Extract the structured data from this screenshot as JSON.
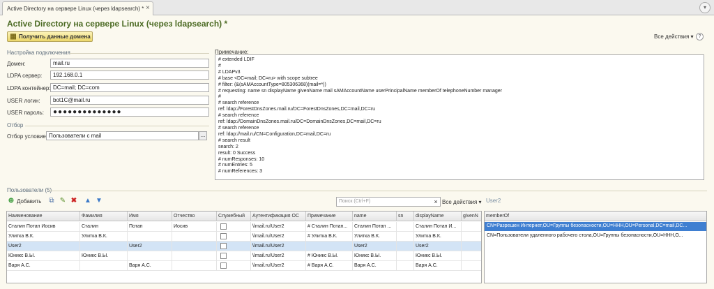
{
  "tab": {
    "title": "Active Directory на сервере Linux (через ldapsearch) *",
    "close": "×",
    "menu": "▾"
  },
  "page": {
    "title": "Active Directory на сервере Linux (через ldapsearch) *",
    "get_domain_button": "Получить данные домена",
    "all_actions": "Все действия ▾",
    "help": "?"
  },
  "connection": {
    "section": "Настройка подключения",
    "domain_label": "Домен:",
    "domain_value": "mail.ru",
    "ldap_server_label": "LDPA сервер:",
    "ldap_server_value": "192.168.0.1",
    "ldap_container_label": "LDPA контейнер:",
    "ldap_container_value": "DC=mail; DC=com",
    "user_login_label": "USER логин:",
    "user_login_value": "bot1C@mail.ru",
    "user_password_label": "USER пароль:",
    "user_password_value": "●●●●●●●●●●●●●●"
  },
  "filter": {
    "section": "Отбор",
    "condition_label": "Отбор условие:",
    "condition_value": "Пользователи с mail",
    "select_button": "..."
  },
  "note": {
    "label": "Примечание:",
    "lines": [
      "# extended LDIF",
      "#",
      "# LDAPv3",
      "# base <DC=mail; DC=ru> with scope subtree",
      "# filter: (&(sAMAccountType=805306368)(mail=*))",
      "# requesting: name sn displayName givenName mail sAMAccountName userPrincipalName memberOf telephoneNumber manager",
      "#",
      "# search reference",
      "ref: ldap://ForestDnsZones.mail.ru/DC=ForestDnsZones,DC=mail,DC=ru",
      "# search reference",
      "ref: ldap://DomainDnsZones.mail.ru/DC=DomainDnsZones,DC=mail,DC=ru",
      "# search reference",
      "ref: ldap://mail.ru/CN=Configuration,DC=mail,DC=ru",
      "# search result",
      "search: 2",
      "result: 0 Success",
      "# numResponses: 10",
      "# numEntries: 5",
      "# numReferences: 3"
    ]
  },
  "users": {
    "section": "Пользователи (5)",
    "add_button": "Добавить",
    "search_placeholder": "Поиск (Ctrl+F)",
    "search_clear": "×",
    "all_actions": "Все действия ▾",
    "columns": [
      "Наименование",
      "Фамилия",
      "Имя",
      "Отчество",
      "Служебный",
      "Аутентификация ОС",
      "Примечание",
      "name",
      "sn",
      "displayName",
      "givenN"
    ],
    "rows": [
      [
        "Сталин Потап Иосив",
        "Сталин",
        "Потап",
        "Иосив",
        "",
        "\\\\mail.ru\\User2",
        "# Сталин Потап...",
        "Сталин Потап ...",
        "",
        "Сталин Потап И...",
        ""
      ],
      [
        "Улитка В.К.",
        "Улитка В.К.",
        "",
        "",
        "",
        "\\\\mail.ru\\User2",
        "# Улитка В.К.",
        "Улитка В.К.",
        "",
        "Улитка В.К.",
        ""
      ],
      [
        "User2",
        "",
        "User2",
        "",
        "",
        "\\\\mail.ru\\User2",
        "",
        "User2",
        "",
        "User2",
        ""
      ],
      [
        "Юникс В.Ы.",
        "Юникс В.Ы.",
        "",
        "",
        "",
        "\\\\mail.ru\\User2",
        "# Юникс В.Ы.",
        "Юникс В.Ы.",
        "",
        "Юникс В.Ы.",
        ""
      ],
      [
        "Варя А.С.",
        "",
        "Варя А.С.",
        "",
        "",
        "\\\\mail.ru\\User2",
        "# Варя А.С.",
        "Варя А.С.",
        "",
        "Варя А.С.",
        ""
      ]
    ],
    "selected_row": 2
  },
  "member_of": {
    "title": "User2",
    "column": "memberOf",
    "rows": [
      "CN=Разрешен Интернет,OU=Группы безопасности,OU=HHH,OU=Personal,DC=mail,DC...",
      "CN=Пользователи удаленного рабочего стола,OU=Группы безопасности,OU=HHH,O..."
    ]
  }
}
